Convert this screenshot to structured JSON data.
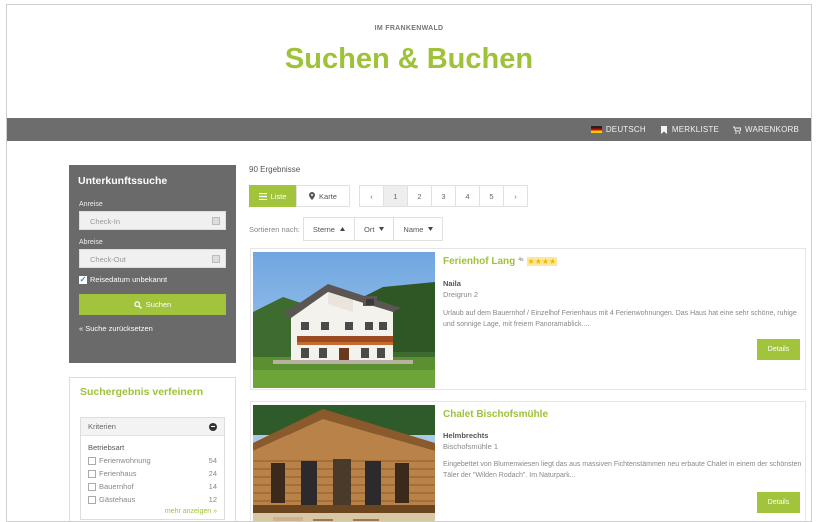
{
  "header": {
    "subtitle": "IM FRANKENWALD",
    "title": "Suchen & Buchen"
  },
  "nav": {
    "language": "DEUTSCH",
    "wishlist": "MERKLISTE",
    "cart": "WARENKORB"
  },
  "search": {
    "title": "Unterkunftssuche",
    "arrival_label": "Anreise",
    "checkin_placeholder": "Check-In",
    "departure_label": "Abreise",
    "checkout_placeholder": "Check-Out",
    "date_unknown_label": "Reisedatum unbekannt",
    "date_unknown_checked": true,
    "search_button": "Suchen",
    "reset_link": "« Suche zurücksetzen"
  },
  "refine": {
    "title": "Suchergebnis verfeinern",
    "criteria_label": "Kriterien",
    "category_title": "Betriebsart",
    "options": [
      {
        "label": "Ferienwohnung",
        "count": "54"
      },
      {
        "label": "Ferienhaus",
        "count": "24"
      },
      {
        "label": "Bauernhof",
        "count": "14"
      },
      {
        "label": "Gästehaus",
        "count": "12"
      }
    ],
    "more_link": "mehr anzeigen »"
  },
  "results": {
    "count_text": "90 Ergebnisse",
    "view_list": "Liste",
    "view_map": "Karte",
    "pages": [
      "‹",
      "1",
      "2",
      "3",
      "4",
      "5",
      "›"
    ],
    "current_page": "1",
    "sort_label": "Sortieren nach:",
    "sort_options": [
      "Sterne",
      "Ort",
      "Name"
    ]
  },
  "listings": [
    {
      "title": "Ferienhof Lang",
      "stars_sup": "4s",
      "stars": 4,
      "town": "Naila",
      "street": "Dreigrun 2",
      "description": "Urlaub auf dem Bauernhof / Einzelhof Ferienhaus mit 4 Ferienwohnungen. Das Haus hat eine sehr schöne, ruhige und sonnige Lage, mit freiem Panoramablick....",
      "details_button": "Details"
    },
    {
      "title": "Chalet Bischofsmühle",
      "town": "Helmbrechts",
      "street": "Bischofsmühle 1",
      "description": "Eingebettet von Blumenwiesen liegt das aus massiven Fichtenstämmen neu erbaute Chalet in einem der schönsten Täler der \"Wilden Rodach\". Im Naturpark...",
      "details_button": "Details"
    }
  ],
  "colors": {
    "accent": "#a2c43c",
    "navbar": "#6d6d6d",
    "panel": "#6a6a6a"
  }
}
